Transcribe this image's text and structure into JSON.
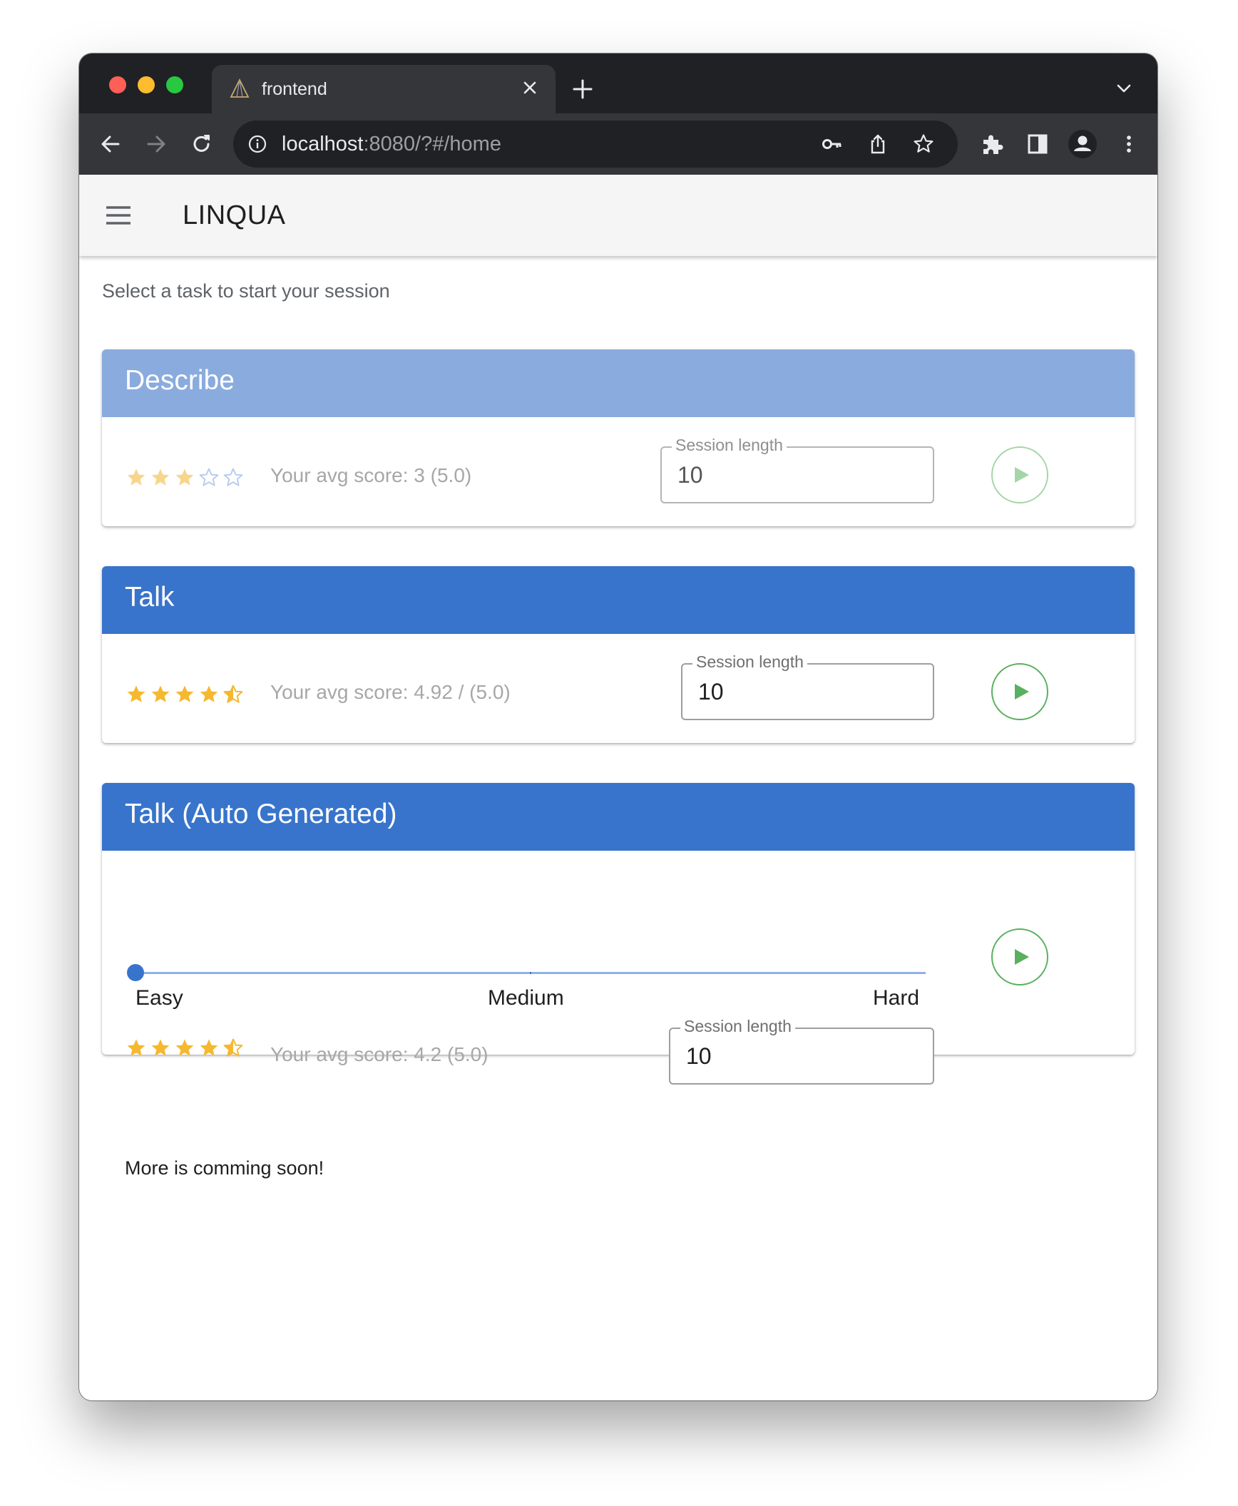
{
  "browser": {
    "tab_title": "frontend",
    "url_host": "localhost",
    "url_path": ":8080/?#/home"
  },
  "app": {
    "title": "LINQUA",
    "subtitle": "Select a task to start your session",
    "footer_note": "More is comming soon!"
  },
  "tasks": [
    {
      "title": "Describe",
      "rating": 3,
      "score_text": "Your avg score: 3 (5.0)",
      "session_label": "Session length",
      "session_value": "10",
      "enabled": false
    },
    {
      "title": "Talk",
      "rating": 4.5,
      "score_text": "Your avg score: 4.92 / (5.0)",
      "session_label": "Session length",
      "session_value": "10",
      "enabled": true
    },
    {
      "title": "Talk (Auto Generated)",
      "rating": 4.5,
      "score_text": "Your avg score: 4.2 (5.0)",
      "session_label": "Session length",
      "session_value": "10",
      "enabled": true,
      "difficulty": {
        "labels": [
          "Easy",
          "Medium",
          "Hard"
        ],
        "selected": "Easy"
      }
    }
  ],
  "colors": {
    "header_light": "#8aabde",
    "header_dark": "#3874cb",
    "star": "#f5b82e",
    "star_empty": "#8fb2e6",
    "play_green": "#5ab05e"
  },
  "icons": [
    "back-arrow-icon",
    "forward-arrow-icon",
    "reload-icon",
    "info-icon",
    "key-icon",
    "share-icon",
    "bookmark-star-icon",
    "extensions-icon",
    "side-panel-icon",
    "profile-icon",
    "kebab-menu-icon",
    "hamburger-menu-icon",
    "play-icon"
  ]
}
